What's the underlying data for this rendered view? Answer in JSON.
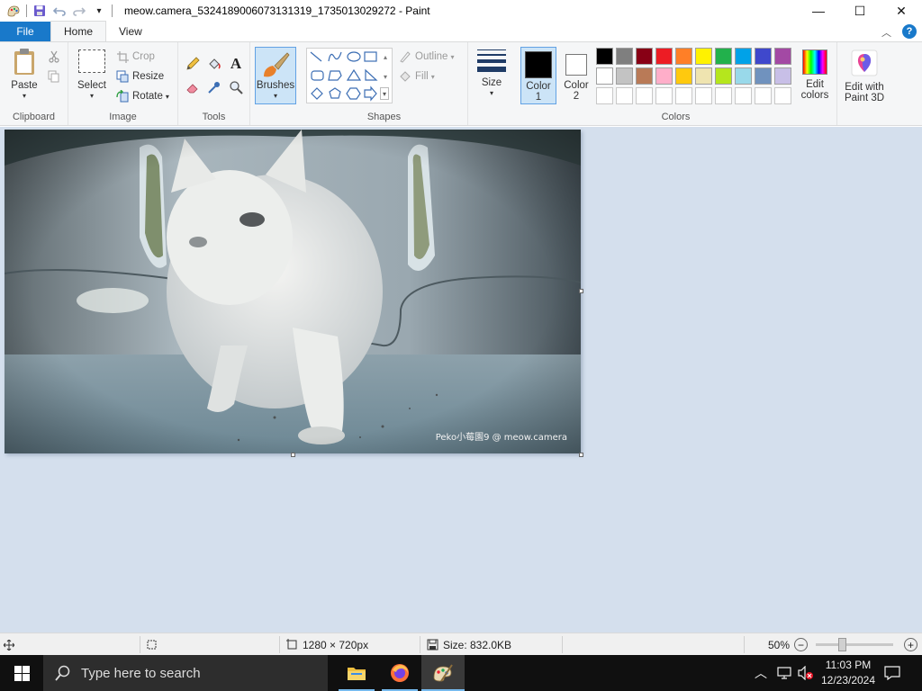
{
  "window": {
    "title": "meow.camera_5324189006073131319_1735013029272 - Paint",
    "controls": {
      "minimize": "—",
      "maximize": "☐",
      "close": "✕"
    }
  },
  "tabs": {
    "file": "File",
    "home": "Home",
    "view": "View"
  },
  "ribbon": {
    "clipboard": {
      "label": "Clipboard",
      "paste": "Paste"
    },
    "image": {
      "label": "Image",
      "select": "Select",
      "crop": "Crop",
      "resize": "Resize",
      "rotate": "Rotate"
    },
    "tools": {
      "label": "Tools"
    },
    "brushes": {
      "label": "Brushes"
    },
    "shapes": {
      "label": "Shapes",
      "outline": "Outline",
      "fill": "Fill"
    },
    "size": {
      "label": "Size"
    },
    "colors": {
      "label": "Colors",
      "color1_line1": "Color",
      "color1_line2": "1",
      "color2_line1": "Color",
      "color2_line2": "2",
      "edit_line1": "Edit",
      "edit_line2": "colors",
      "color1_value": "#000000",
      "color2_value": "#ffffff",
      "palette_row1": [
        "#000000",
        "#7f7f7f",
        "#880015",
        "#ed1c24",
        "#ff7f27",
        "#fff200",
        "#22b14c",
        "#00a2e8",
        "#3f48cc",
        "#a349a4"
      ],
      "palette_row2": [
        "#ffffff",
        "#c3c3c3",
        "#b97a57",
        "#ffaec9",
        "#ffc90e",
        "#efe4b0",
        "#b5e61d",
        "#99d9ea",
        "#7092be",
        "#c8bfe7"
      ],
      "palette_row3": [
        "#ffffff",
        "#ffffff",
        "#ffffff",
        "#ffffff",
        "#ffffff",
        "#ffffff",
        "#ffffff",
        "#ffffff",
        "#ffffff",
        "#ffffff"
      ]
    },
    "paint3d": {
      "line1": "Edit with",
      "line2": "Paint 3D"
    }
  },
  "image": {
    "watermark": "Peko小莓園9 @ meow.camera"
  },
  "statusbar": {
    "dimensions": "1280 × 720px",
    "size": "Size: 832.0KB",
    "zoom": "50%",
    "zoom_level": 0.5
  },
  "taskbar": {
    "search_placeholder": "Type here to search",
    "time": "11:03 PM",
    "date": "12/23/2024"
  }
}
